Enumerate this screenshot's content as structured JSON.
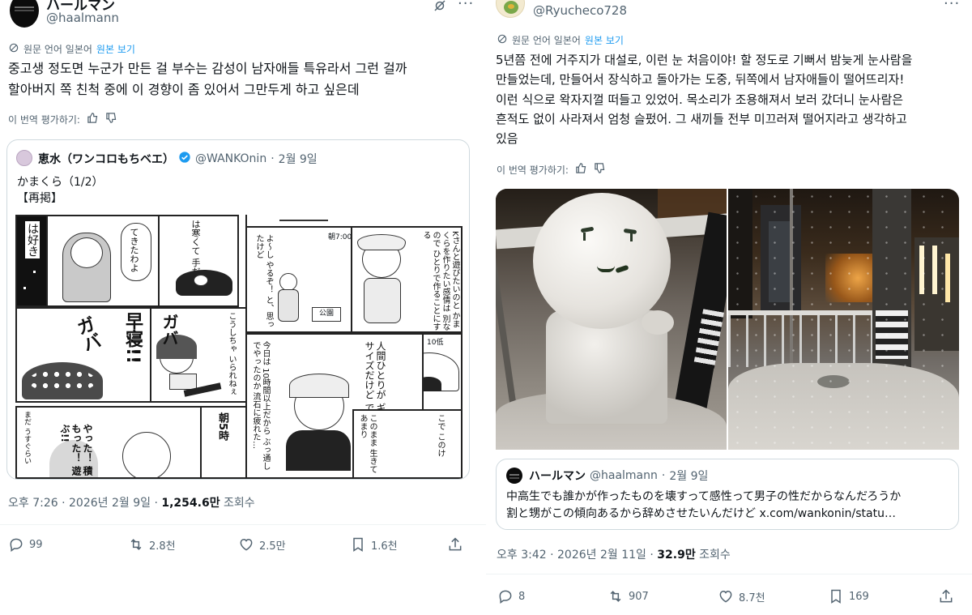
{
  "left_post": {
    "display_name": "ハールマン",
    "handle": "@haalmann",
    "translated_note": "원문 언어 일본어",
    "show_original": "원본 보기",
    "text": "중고생 정도면 누군가 만든 걸 부수는 감성이 남자애들 특유라서 그런 걸까\n할아버지 쪽 친척 중에 이 경향이 좀 있어서 그만두게 하고 싶은데",
    "rate_translation": "이 번역 평가하기:",
    "quote": {
      "display_name": "恵水（ワンコロもちベエ）",
      "handle": "@WANKOnin",
      "date": "2월 9일",
      "text": "かまくら（1/2）\n【再掲】",
      "manga_text": {
        "p1": "は好き",
        "p2a": "てきたわよ",
        "p2b": "は寒くて 手だけど",
        "p3": "よ〜し やるぞ！ と、思ったけど",
        "p3_sign": "公園",
        "p3_time": "朝7:00",
        "p4": "Kさんと遊びたいのと かまくらを作りたい感情は 別なので ひとりで作ることにする",
        "p5_sfx": "ガバ",
        "p5_big": "早寝!!",
        "p5_sfx2": "ガバ",
        "p5_small": "こうしちゃ いられねぇ",
        "p6a": "今日は 10時間以上だから ぶっ通しでやったのか 流石に疲れた…",
        "p6b": "人間ひとりが ギリギリ入れる サイズだけど できた",
        "p6c": "10低",
        "p7": "朝5時",
        "p8": "まだ うすぐらい",
        "p8b": "やった！ 積もった！ 遊ぶ!!",
        "p9": "このまま 生きて あまり",
        "p9b": "こで このけ"
      }
    },
    "time": "오후 7:26",
    "date": "2026년 2월 9일",
    "views_count": "1,254.6만",
    "views_label": "조회수",
    "actions": {
      "replies": "99",
      "reposts": "2.8천",
      "likes": "2.5만",
      "bookmarks": "1.6천"
    }
  },
  "right_post": {
    "handle": "@Ryucheco728",
    "translated_note": "원문 언어 일본어",
    "show_original": "원본 보기",
    "text": "5년쯤 전에 거주지가 대설로, 이런 눈 처음이야! 할 정도로 기뻐서 밤늦게 눈사람을\n만들었는데, 만들어서 장식하고 돌아가는 도중, 뒤쪽에서 남자애들이 떨어뜨리자!\n이런 식으로 왁자지껄 떠들고 있었어. 목소리가 조용해져서 보러 갔더니 눈사람은\n흔적도 없이 사라져서 엄청 슬펐어. 그 새끼들 전부 미끄러져 떨어지라고 생각하고\n있음",
    "rate_translation": "이 번역 평가하기:",
    "quote": {
      "display_name": "ハールマン",
      "handle": "@haalmann",
      "date": "2월 9일",
      "text": "中高生でも誰かが作ったものを壊すって感性って男子の性だからなんだろうか\n割と甥がこの傾向あるから辞めさせたいんだけど x.com/wankonin/statu…"
    },
    "time": "오후 3:42",
    "date": "2026년 2월 11일",
    "views_count": "32.9만",
    "views_label": "조회수",
    "actions": {
      "replies": "8",
      "reposts": "907",
      "likes": "8.7천",
      "bookmarks": "169"
    }
  },
  "separator": "·",
  "colors": {
    "link": "#1d9bf0",
    "secondary": "#536471",
    "border": "#cfd9de",
    "verified": "#1d9bf0"
  }
}
